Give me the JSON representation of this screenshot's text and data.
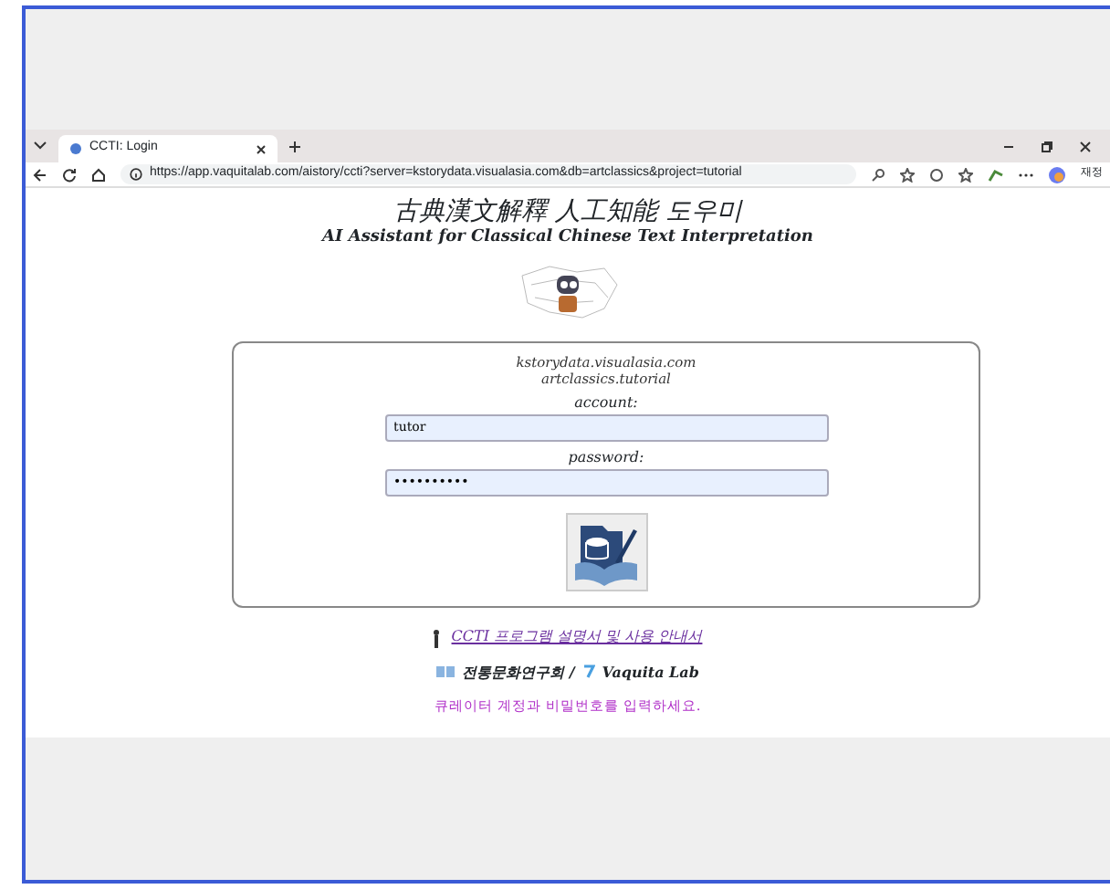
{
  "browser": {
    "tabs": [
      {
        "title": "CCTI: Login",
        "selected": true
      }
    ],
    "url": "https://app.vaquitalab.com/aistory/ccti?server=kstorydata.visualasia.com&db=artclassics&project=tutorial",
    "profile_label": "재정"
  },
  "page": {
    "title": "古典漢文解釋 人工知能 도우미",
    "subtitle": "AI Assistant for Classical Chinese Text Interpretation",
    "login": {
      "server": "kstorydata.visualasia.com",
      "database": "artclassics.tutorial",
      "fields": [
        {
          "label": "account:",
          "value": "tutor"
        },
        {
          "label": "password:",
          "value": "••••••••••"
        }
      ]
    },
    "manual_link": "CCTI 프로그램 설명서 및 사용 안내서",
    "credits": [
      {
        "text": "전통문화연구회 /"
      },
      {
        "text": "Vaquita Lab"
      }
    ],
    "message": "큐레이터 계정과 비밀번호를 입력하세요."
  }
}
